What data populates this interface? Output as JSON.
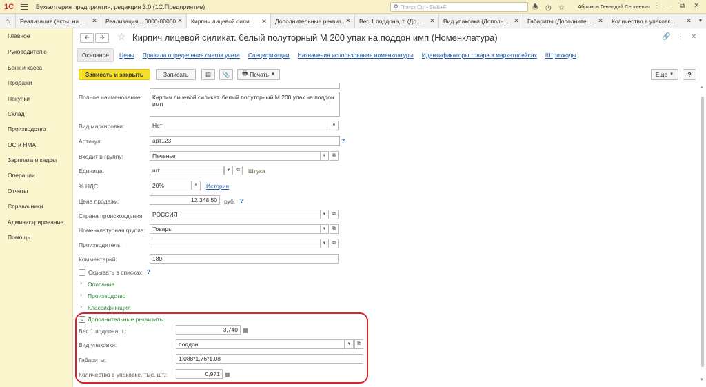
{
  "titlebar": {
    "logo": "1С",
    "app_title": "Бухгалтерия предприятия, редакция 3.0  (1С:Предприятие)",
    "search_placeholder": "Поиск Ctrl+Shift+F",
    "user": "Абрамов Геннадий Сергеевич"
  },
  "tabs": [
    {
      "label": "Реализация (акты, на..."
    },
    {
      "label": "Реализация ...0000-000602"
    },
    {
      "label": "Кирпич лицевой сили..."
    },
    {
      "label": "Дополнительные реквиз..."
    },
    {
      "label": "Вес 1 поддона, т. (До..."
    },
    {
      "label": "Вид упаковки (Дополн..."
    },
    {
      "label": "Габариты (Дополните..."
    },
    {
      "label": "Количество в упаковк..."
    }
  ],
  "sidebar": {
    "items": [
      {
        "label": "Главное"
      },
      {
        "label": "Руководителю"
      },
      {
        "label": "Банк и касса"
      },
      {
        "label": "Продажи"
      },
      {
        "label": "Покупки"
      },
      {
        "label": "Склад"
      },
      {
        "label": "Производство"
      },
      {
        "label": "ОС и НМА"
      },
      {
        "label": "Зарплата и кадры"
      },
      {
        "label": "Операции"
      },
      {
        "label": "Отчеты"
      },
      {
        "label": "Справочники"
      },
      {
        "label": "Администрирование"
      },
      {
        "label": "Помощь"
      }
    ]
  },
  "form": {
    "title": "Кирпич лицевой силикат. белый полуторный М 200 упак на поддон имп (Номенклатура)",
    "section_tabs": [
      {
        "label": "Основное"
      },
      {
        "label": "Цены"
      },
      {
        "label": "Правила определения счетов учета"
      },
      {
        "label": "Спецификации"
      },
      {
        "label": "Назначения использования номенклатуры"
      },
      {
        "label": "Идентификаторы товара в маркетплейсах"
      },
      {
        "label": "Штрихкоды"
      }
    ],
    "toolbar": {
      "save_close": "Записать и закрыть",
      "save": "Записать",
      "print": "Печать",
      "more": "Еще",
      "help": "?"
    }
  },
  "fields": {
    "full_name_label": "Полное наименование:",
    "full_name_value": "Кирпич лицевой силикат. белый полуторный М 200 упак на поддон имп",
    "marking_label": "Вид маркировки:",
    "marking_value": "Нет",
    "article_label": "Артикул:",
    "article_value": "арт123",
    "group_label": "Входит в группу:",
    "group_value": "Печенье",
    "unit_label": "Единица:",
    "unit_value": "шт",
    "unit_hint": "Штука",
    "vat_label": "% НДС:",
    "vat_value": "20%",
    "vat_history": "История",
    "price_label": "Цена продажи:",
    "price_value": "12 348,50",
    "price_currency": "руб.",
    "country_label": "Страна происхождения:",
    "country_value": "РОССИЯ",
    "nom_group_label": "Номенклатурная группа:",
    "nom_group_value": "Товары",
    "producer_label": "Производитель:",
    "producer_value": "",
    "comment_label": "Комментарий:",
    "comment_value": "180",
    "hide_in_lists": "Скрывать в списках",
    "help_mark": "?"
  },
  "groups": {
    "description": "Описание",
    "production": "Производство",
    "classification": "Классификация",
    "extra_props": "Дополнительные реквизиты"
  },
  "extra": {
    "pallet_weight_label": "Вес 1 поддона, т.:",
    "pallet_weight_value": "3,740",
    "package_type_label": "Вид упаковки:",
    "package_type_value": "поддон",
    "dimensions_label": "Габариты:",
    "dimensions_value": "1,088*1,76*1,08",
    "qty_per_pack_label": "Количество в упаковке, тыс. шт.:",
    "qty_per_pack_value": "0,971"
  },
  "colors": {
    "accent_yellow": "#f5df2d",
    "sidebar_bg": "#fcf6cf",
    "link_blue": "#1a55a8",
    "group_green": "#2d8a3e",
    "highlight_red": "#d8232a"
  }
}
